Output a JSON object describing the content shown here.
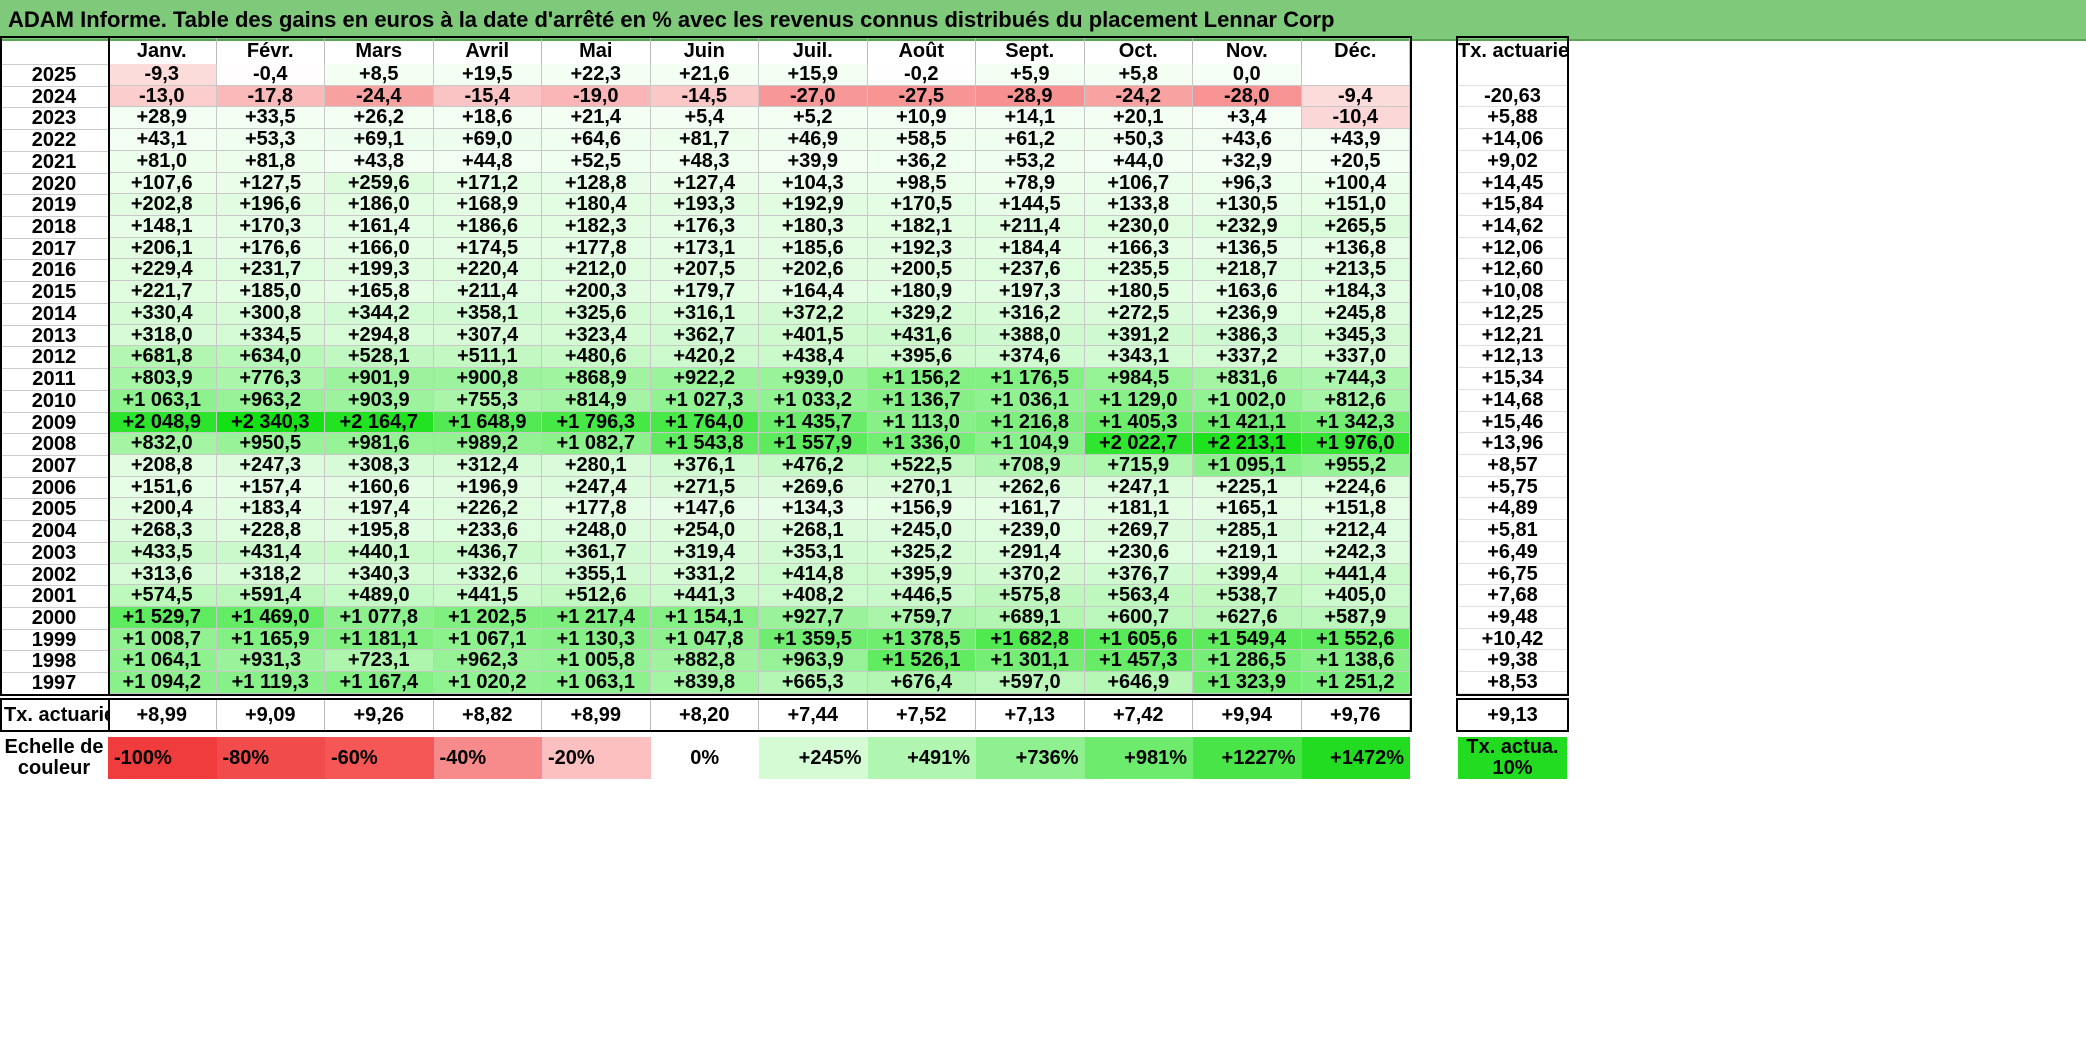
{
  "title": "ADAM Informe. Table des gains en euros à la date d'arrêté en % avec les revenus connus distribués du placement Lennar Corp",
  "months": [
    "Janv.",
    "Févr.",
    "Mars",
    "Avril",
    "Mai",
    "Juin",
    "Juil.",
    "Août",
    "Sept.",
    "Oct.",
    "Nov.",
    "Déc."
  ],
  "rate_header": "Tx. actuariel",
  "rows": [
    {
      "year": "2025",
      "values": [
        "-9,3",
        "-0,4",
        "+8,5",
        "+19,5",
        "+22,3",
        "+21,6",
        "+15,9",
        "-0,2",
        "+5,9",
        "+5,8",
        "0,0",
        ""
      ],
      "rate": ""
    },
    {
      "year": "2024",
      "values": [
        "-13,0",
        "-17,8",
        "-24,4",
        "-15,4",
        "-19,0",
        "-14,5",
        "-27,0",
        "-27,5",
        "-28,9",
        "-24,2",
        "-28,0",
        "-9,4"
      ],
      "rate": "-20,63"
    },
    {
      "year": "2023",
      "values": [
        "+28,9",
        "+33,5",
        "+26,2",
        "+18,6",
        "+21,4",
        "+5,4",
        "+5,2",
        "+10,9",
        "+14,1",
        "+20,1",
        "+3,4",
        "-10,4"
      ],
      "rate": "+5,88"
    },
    {
      "year": "2022",
      "values": [
        "+43,1",
        "+53,3",
        "+69,1",
        "+69,0",
        "+64,6",
        "+81,7",
        "+46,9",
        "+58,5",
        "+61,2",
        "+50,3",
        "+43,6",
        "+43,9"
      ],
      "rate": "+14,06"
    },
    {
      "year": "2021",
      "values": [
        "+81,0",
        "+81,8",
        "+43,8",
        "+44,8",
        "+52,5",
        "+48,3",
        "+39,9",
        "+36,2",
        "+53,2",
        "+44,0",
        "+32,9",
        "+20,5"
      ],
      "rate": "+9,02"
    },
    {
      "year": "2020",
      "values": [
        "+107,6",
        "+127,5",
        "+259,6",
        "+171,2",
        "+128,8",
        "+127,4",
        "+104,3",
        "+98,5",
        "+78,9",
        "+106,7",
        "+96,3",
        "+100,4"
      ],
      "rate": "+14,45"
    },
    {
      "year": "2019",
      "values": [
        "+202,8",
        "+196,6",
        "+186,0",
        "+168,9",
        "+180,4",
        "+193,3",
        "+192,9",
        "+170,5",
        "+144,5",
        "+133,8",
        "+130,5",
        "+151,0"
      ],
      "rate": "+15,84"
    },
    {
      "year": "2018",
      "values": [
        "+148,1",
        "+170,3",
        "+161,4",
        "+186,6",
        "+182,3",
        "+176,3",
        "+180,3",
        "+182,1",
        "+211,4",
        "+230,0",
        "+232,9",
        "+265,5"
      ],
      "rate": "+14,62"
    },
    {
      "year": "2017",
      "values": [
        "+206,1",
        "+176,6",
        "+166,0",
        "+174,5",
        "+177,8",
        "+173,1",
        "+185,6",
        "+192,3",
        "+184,4",
        "+166,3",
        "+136,5",
        "+136,8"
      ],
      "rate": "+12,06"
    },
    {
      "year": "2016",
      "values": [
        "+229,4",
        "+231,7",
        "+199,3",
        "+220,4",
        "+212,0",
        "+207,5",
        "+202,6",
        "+200,5",
        "+237,6",
        "+235,5",
        "+218,7",
        "+213,5"
      ],
      "rate": "+12,60"
    },
    {
      "year": "2015",
      "values": [
        "+221,7",
        "+185,0",
        "+165,8",
        "+211,4",
        "+200,3",
        "+179,7",
        "+164,4",
        "+180,9",
        "+197,3",
        "+180,5",
        "+163,6",
        "+184,3"
      ],
      "rate": "+10,08"
    },
    {
      "year": "2014",
      "values": [
        "+330,4",
        "+300,8",
        "+344,2",
        "+358,1",
        "+325,6",
        "+316,1",
        "+372,2",
        "+329,2",
        "+316,2",
        "+272,5",
        "+236,9",
        "+245,8"
      ],
      "rate": "+12,25"
    },
    {
      "year": "2013",
      "values": [
        "+318,0",
        "+334,5",
        "+294,8",
        "+307,4",
        "+323,4",
        "+362,7",
        "+401,5",
        "+431,6",
        "+388,0",
        "+391,2",
        "+386,3",
        "+345,3"
      ],
      "rate": "+12,21"
    },
    {
      "year": "2012",
      "values": [
        "+681,8",
        "+634,0",
        "+528,1",
        "+511,1",
        "+480,6",
        "+420,2",
        "+438,4",
        "+395,6",
        "+374,6",
        "+343,1",
        "+337,2",
        "+337,0"
      ],
      "rate": "+12,13"
    },
    {
      "year": "2011",
      "values": [
        "+803,9",
        "+776,3",
        "+901,9",
        "+900,8",
        "+868,9",
        "+922,2",
        "+939,0",
        "+1 156,2",
        "+1 176,5",
        "+984,5",
        "+831,6",
        "+744,3"
      ],
      "rate": "+15,34"
    },
    {
      "year": "2010",
      "values": [
        "+1 063,1",
        "+963,2",
        "+903,9",
        "+755,3",
        "+814,9",
        "+1 027,3",
        "+1 033,2",
        "+1 136,7",
        "+1 036,1",
        "+1 129,0",
        "+1 002,0",
        "+812,6"
      ],
      "rate": "+14,68"
    },
    {
      "year": "2009",
      "values": [
        "+2 048,9",
        "+2 340,3",
        "+2 164,7",
        "+1 648,9",
        "+1 796,3",
        "+1 764,0",
        "+1 435,7",
        "+1 113,0",
        "+1 216,8",
        "+1 405,3",
        "+1 421,1",
        "+1 342,3"
      ],
      "rate": "+15,46"
    },
    {
      "year": "2008",
      "values": [
        "+832,0",
        "+950,5",
        "+981,6",
        "+989,2",
        "+1 082,7",
        "+1 543,8",
        "+1 557,9",
        "+1 336,0",
        "+1 104,9",
        "+2 022,7",
        "+2 213,1",
        "+1 976,0"
      ],
      "rate": "+13,96"
    },
    {
      "year": "2007",
      "values": [
        "+208,8",
        "+247,3",
        "+308,3",
        "+312,4",
        "+280,1",
        "+376,1",
        "+476,2",
        "+522,5",
        "+708,9",
        "+715,9",
        "+1 095,1",
        "+955,2"
      ],
      "rate": "+8,57"
    },
    {
      "year": "2006",
      "values": [
        "+151,6",
        "+157,4",
        "+160,6",
        "+196,9",
        "+247,4",
        "+271,5",
        "+269,6",
        "+270,1",
        "+262,6",
        "+247,1",
        "+225,1",
        "+224,6"
      ],
      "rate": "+5,75"
    },
    {
      "year": "2005",
      "values": [
        "+200,4",
        "+183,4",
        "+197,4",
        "+226,2",
        "+177,8",
        "+147,6",
        "+134,3",
        "+156,9",
        "+161,7",
        "+181,1",
        "+165,1",
        "+151,8"
      ],
      "rate": "+4,89"
    },
    {
      "year": "2004",
      "values": [
        "+268,3",
        "+228,8",
        "+195,8",
        "+233,6",
        "+248,0",
        "+254,0",
        "+268,1",
        "+245,0",
        "+239,0",
        "+269,7",
        "+285,1",
        "+212,4"
      ],
      "rate": "+5,81"
    },
    {
      "year": "2003",
      "values": [
        "+433,5",
        "+431,4",
        "+440,1",
        "+436,7",
        "+361,7",
        "+319,4",
        "+353,1",
        "+325,2",
        "+291,4",
        "+230,6",
        "+219,1",
        "+242,3"
      ],
      "rate": "+6,49"
    },
    {
      "year": "2002",
      "values": [
        "+313,6",
        "+318,2",
        "+340,3",
        "+332,6",
        "+355,1",
        "+331,2",
        "+414,8",
        "+395,9",
        "+370,2",
        "+376,7",
        "+399,4",
        "+441,4"
      ],
      "rate": "+6,75"
    },
    {
      "year": "2001",
      "values": [
        "+574,5",
        "+591,4",
        "+489,0",
        "+441,5",
        "+512,6",
        "+441,3",
        "+408,2",
        "+446,5",
        "+575,8",
        "+563,4",
        "+538,7",
        "+405,0"
      ],
      "rate": "+7,68"
    },
    {
      "year": "2000",
      "values": [
        "+1 529,7",
        "+1 469,0",
        "+1 077,8",
        "+1 202,5",
        "+1 217,4",
        "+1 154,1",
        "+927,7",
        "+759,7",
        "+689,1",
        "+600,7",
        "+627,6",
        "+587,9"
      ],
      "rate": "+9,48"
    },
    {
      "year": "1999",
      "values": [
        "+1 008,7",
        "+1 165,9",
        "+1 181,1",
        "+1 067,1",
        "+1 130,3",
        "+1 047,8",
        "+1 359,5",
        "+1 378,5",
        "+1 682,8",
        "+1 605,6",
        "+1 549,4",
        "+1 552,6"
      ],
      "rate": "+10,42"
    },
    {
      "year": "1998",
      "values": [
        "+1 064,1",
        "+931,3",
        "+723,1",
        "+962,3",
        "+1 005,8",
        "+882,8",
        "+963,9",
        "+1 526,1",
        "+1 301,1",
        "+1 457,3",
        "+1 286,5",
        "+1 138,6"
      ],
      "rate": "+9,38"
    },
    {
      "year": "1997",
      "values": [
        "+1 094,2",
        "+1 119,3",
        "+1 167,4",
        "+1 020,2",
        "+1 063,1",
        "+839,8",
        "+665,3",
        "+676,4",
        "+597,0",
        "+646,9",
        "+1 323,9",
        "+1 251,2"
      ],
      "rate": "+8,53"
    }
  ],
  "footer": {
    "label": "Tx. actuariel",
    "values": [
      "+8,99",
      "+9,09",
      "+9,26",
      "+8,82",
      "+8,99",
      "+8,20",
      "+7,44",
      "+7,52",
      "+7,13",
      "+7,42",
      "+9,94",
      "+9,76"
    ],
    "rate": "+9,13"
  },
  "scale": {
    "label": "Echelle de couleur",
    "stops": [
      "-100%",
      "-80%",
      "-60%",
      "-40%",
      "-20%",
      "0%",
      "+245%",
      "+491%",
      "+736%",
      "+981%",
      "+1227%",
      "+1472%"
    ],
    "stop_colors": [
      "#f03c3c",
      "#f24b4b",
      "#f55656",
      "#f78b8b",
      "#fcc0c0",
      "#ffffff",
      "#d5fbd5",
      "#b0f6b0",
      "#8ff08f",
      "#6deb6d",
      "#48e448",
      "#22dc22"
    ],
    "rate_label": "Tx. actua. 10%",
    "rate_color": "#22dc22"
  },
  "colors": {
    "title_bg": "#7fc97a",
    "positive_max": "#1ee11e",
    "negative_max": "#f04040"
  }
}
